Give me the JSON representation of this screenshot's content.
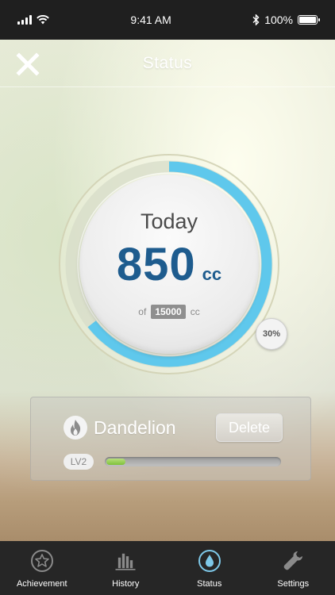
{
  "status_bar": {
    "time": "9:41 AM",
    "battery_text": "100%",
    "battery_level": 1.0
  },
  "header": {
    "title": "Status"
  },
  "intake": {
    "label": "Today",
    "amount": "850",
    "unit": "cc",
    "goal_prefix": "of",
    "goal": "15000",
    "goal_unit": "cc",
    "percent_text": "30%",
    "progress": 0.3
  },
  "plant": {
    "name": "Dandelion",
    "delete_label": "Delete",
    "level_label": "LV2",
    "level_progress": 0.11
  },
  "tabs": [
    {
      "label": "Achievement",
      "icon": "star-badge-icon",
      "active": false
    },
    {
      "label": "History",
      "icon": "bar-chart-icon",
      "active": false
    },
    {
      "label": "Status",
      "icon": "water-drop-icon",
      "active": true
    },
    {
      "label": "Settings",
      "icon": "wrench-icon",
      "active": false
    }
  ],
  "colors": {
    "accent_blue": "#1e5c8e",
    "ring_blue": "#5fc8ec",
    "level_green": "#8cc94a",
    "tab_active": "#7ec8e8"
  }
}
